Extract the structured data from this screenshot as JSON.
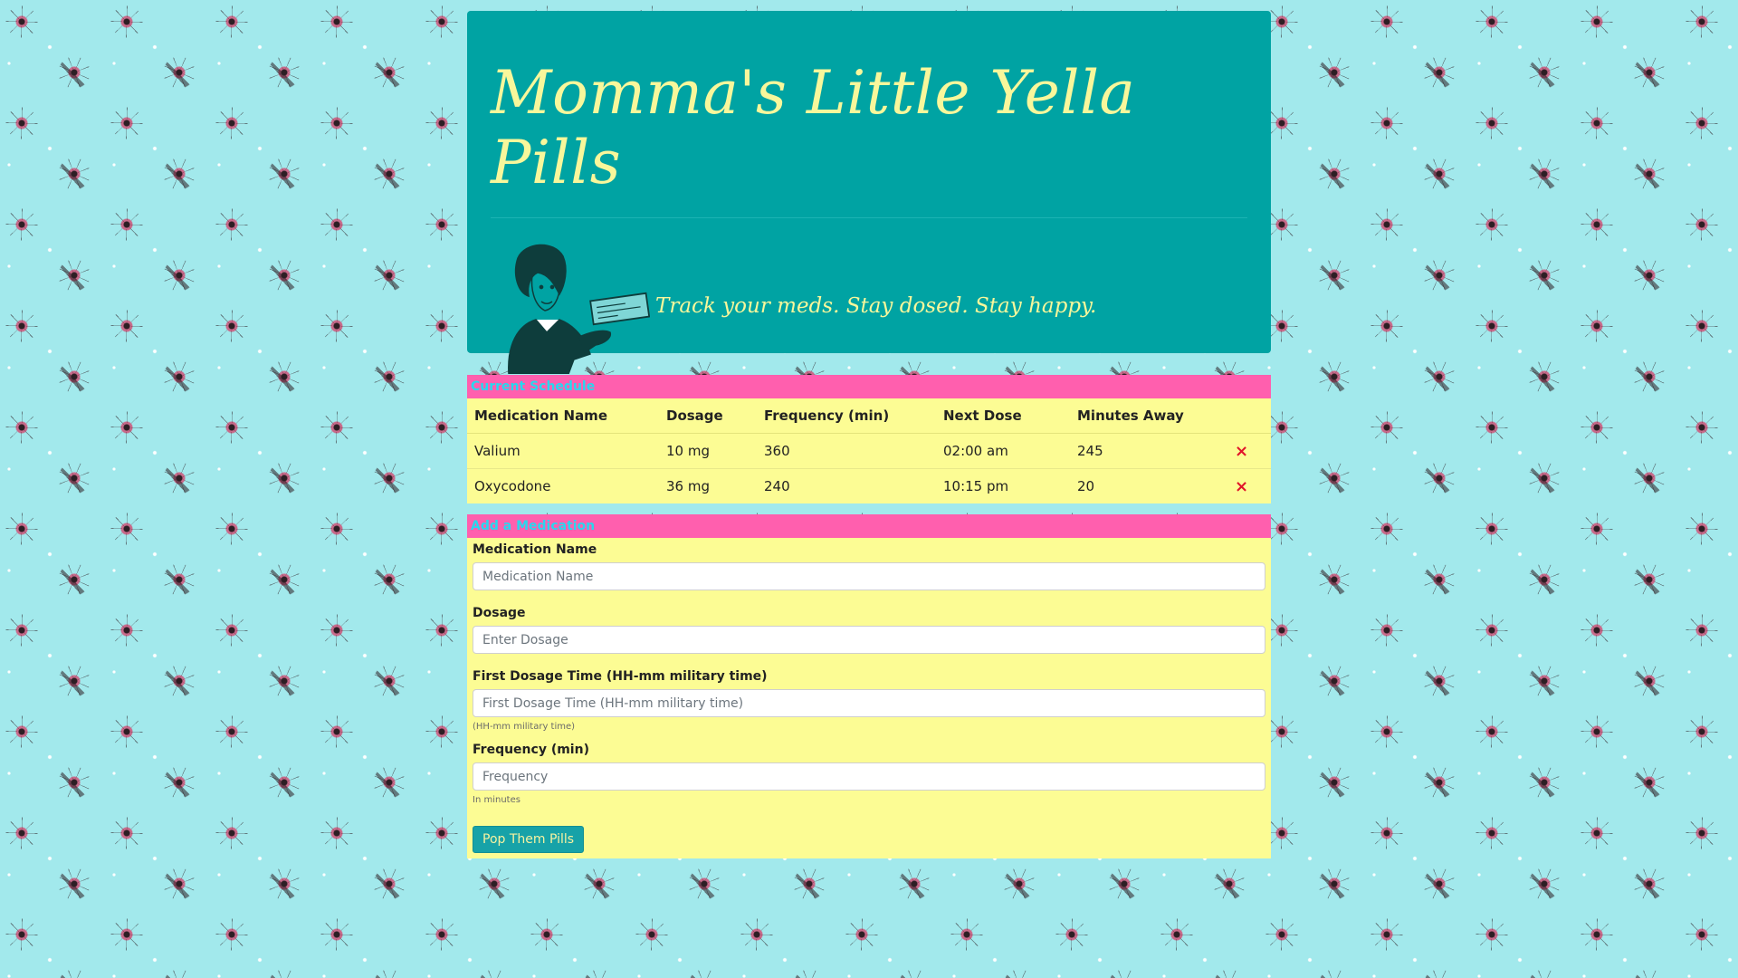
{
  "header": {
    "title": "Momma's Little Yella Pills",
    "tagline": "Track your meds. Stay dosed. Stay happy."
  },
  "schedule": {
    "heading": "Current Schedule",
    "columns": [
      "Medication Name",
      "Dosage",
      "Frequency (min)",
      "Next Dose",
      "Minutes Away"
    ],
    "rows": [
      {
        "name": "Valium",
        "dosage": "10 mg",
        "frequency": "360",
        "next_dose": "02:00 am",
        "minutes_away": "245",
        "delete": "×"
      },
      {
        "name": "Oxycodone",
        "dosage": "36 mg",
        "frequency": "240",
        "next_dose": "10:15 pm",
        "minutes_away": "20",
        "delete": "×"
      }
    ]
  },
  "add_form": {
    "heading": "Add a Medication",
    "fields": [
      {
        "label": "Medication Name",
        "placeholder": "Medication Name",
        "value": "",
        "help": ""
      },
      {
        "label": "Dosage",
        "placeholder": "Enter Dosage",
        "value": "",
        "help": ""
      },
      {
        "label": "First Dosage Time (HH-mm military time)",
        "placeholder": "First Dosage Time (HH-mm military time)",
        "value": "",
        "help": "(HH-mm military time)"
      },
      {
        "label": "Frequency (min)",
        "placeholder": "Frequency",
        "value": "",
        "help": "In minutes"
      }
    ],
    "submit_label": "Pop Them Pills"
  },
  "colors": {
    "jumbotron": "#00a3a3",
    "title_text": "#f8f79b",
    "panel_heading": "#ff5fae",
    "panel_heading_text": "#28d7ee",
    "panel_body": "#fcfc94",
    "delete": "#e0142a",
    "button": "#17a2a8"
  },
  "icons": {
    "hero": "retro-woman-with-check-illustration",
    "delete": "close-icon"
  }
}
